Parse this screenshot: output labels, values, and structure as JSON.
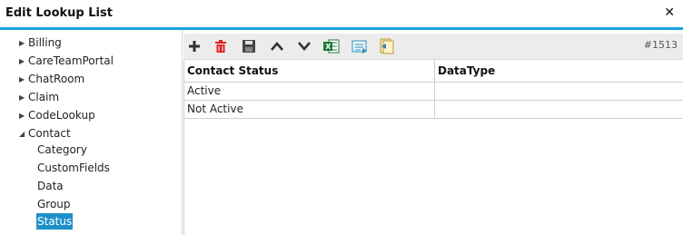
{
  "window": {
    "title": "Edit Lookup List",
    "close_glyph": "✕"
  },
  "tree": {
    "items": [
      {
        "label": "Billing",
        "expanded": false
      },
      {
        "label": "CareTeamPortal",
        "expanded": false
      },
      {
        "label": "ChatRoom",
        "expanded": false
      },
      {
        "label": "Claim",
        "expanded": false
      },
      {
        "label": "CodeLookup",
        "expanded": false
      },
      {
        "label": "Contact",
        "expanded": true
      }
    ],
    "children": [
      {
        "label": "Category"
      },
      {
        "label": "CustomFields"
      },
      {
        "label": "Data"
      },
      {
        "label": "Group"
      },
      {
        "label": "Status",
        "selected": true
      }
    ]
  },
  "toolbar": {
    "icons": [
      "add-icon",
      "delete-icon",
      "save-icon",
      "move-up-icon",
      "move-down-icon",
      "export-excel-icon",
      "export-csv-icon",
      "import-icon"
    ],
    "record_id": "#1513"
  },
  "grid": {
    "columns": [
      "Contact Status",
      "DataType"
    ],
    "rows": [
      [
        "Active",
        ""
      ],
      [
        "Not Active",
        ""
      ]
    ]
  },
  "colors": {
    "accent": "#1ba1e2",
    "selected": "#1e90c8",
    "delete": "#e02020"
  }
}
